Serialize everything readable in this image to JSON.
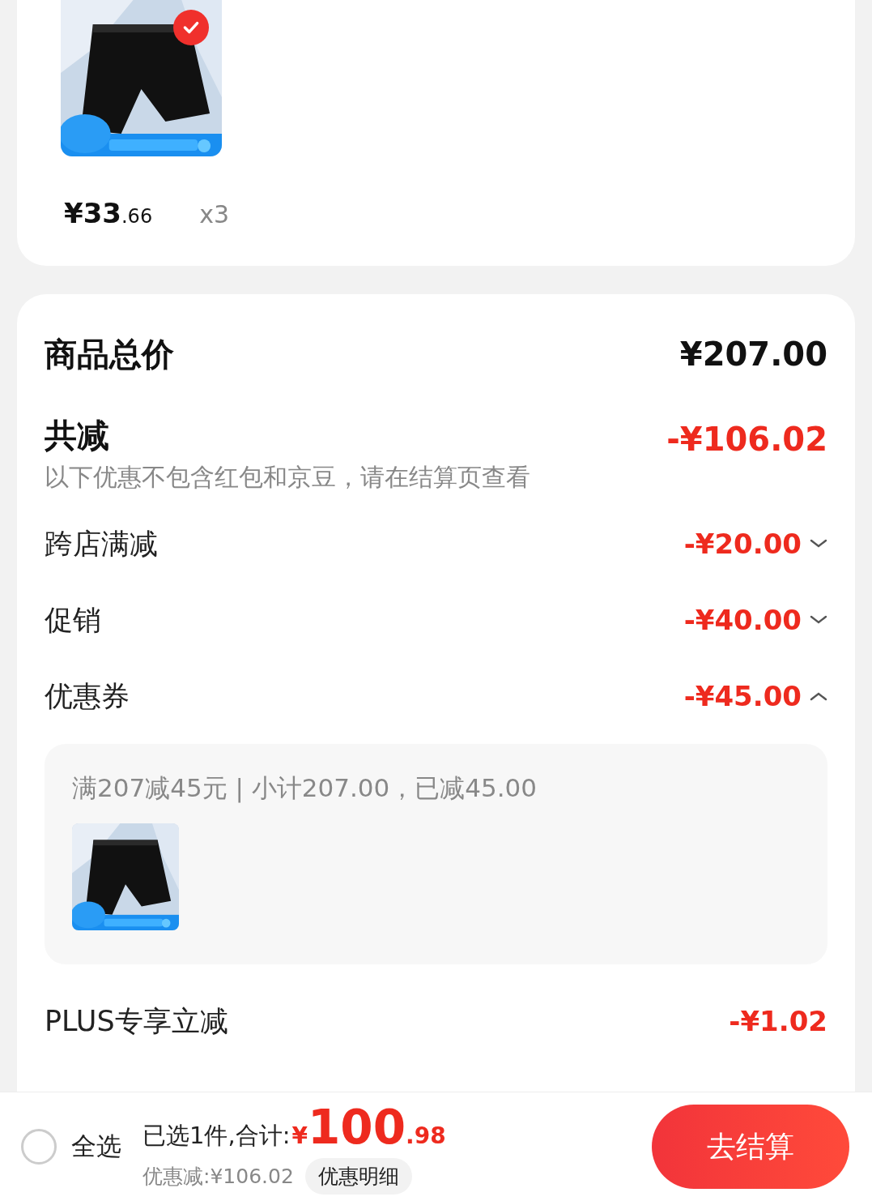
{
  "product": {
    "selected": true,
    "price_main": "¥33",
    "price_decimal": ".66",
    "quantity": "x3"
  },
  "summary": {
    "total": {
      "label": "商品总价",
      "value": "¥207.00"
    },
    "discount": {
      "label": "共减",
      "value": "-¥106.02",
      "note": "以下优惠不包含红包和京豆，请在结算页查看"
    },
    "items": [
      {
        "label": "跨店满减",
        "value": "-¥20.00",
        "expanded": false
      },
      {
        "label": "促销",
        "value": "-¥40.00",
        "expanded": false
      },
      {
        "label": "优惠券",
        "value": "-¥45.00",
        "expanded": true,
        "detail": {
          "text": "满207减45元 | 小计207.00，已减45.00"
        }
      }
    ],
    "plus": {
      "label": "PLUS专享立减",
      "value": "-¥1.02"
    }
  },
  "bottom_bar": {
    "select_all": {
      "label": "全选",
      "checked": false
    },
    "selected_count": "已选1件,合计:",
    "currency": "¥",
    "total_main": "100",
    "total_decimal": ".98",
    "discount": "优惠减:¥106.02",
    "detail_button": "优惠明细",
    "checkout_button": "去结算"
  }
}
